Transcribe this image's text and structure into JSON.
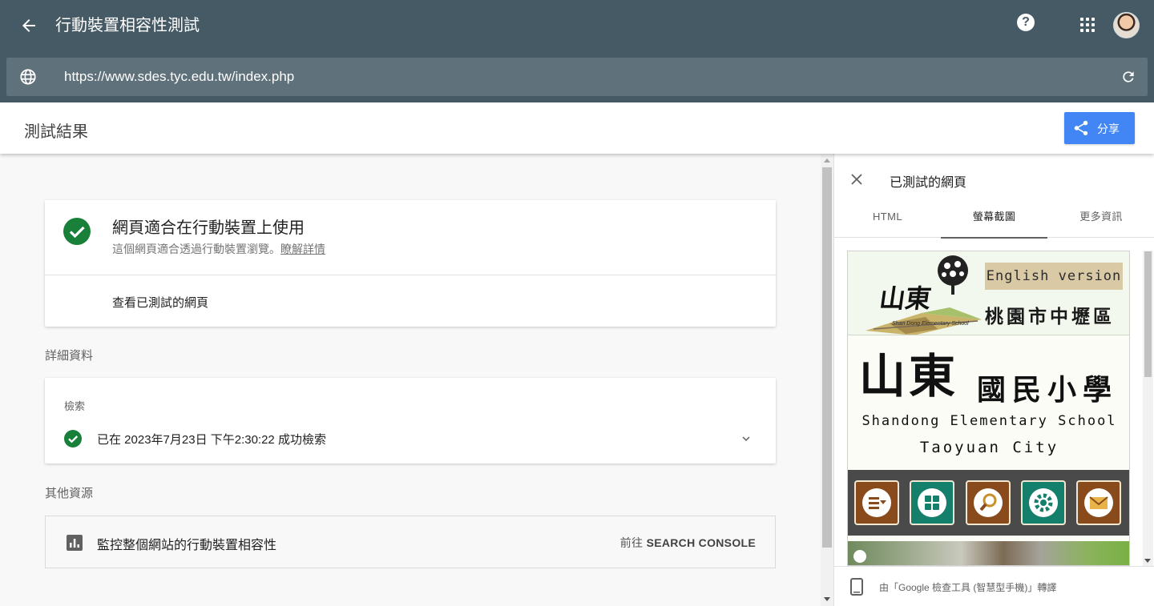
{
  "app": {
    "title": "行動裝置相容性測試",
    "help_label": "?"
  },
  "url_bar": {
    "url": "https://www.sdes.tyc.edu.tw/index.php"
  },
  "header": {
    "title": "測試結果",
    "share_label": "分享"
  },
  "result_card": {
    "title": "網頁適合在行動裝置上使用",
    "subtitle": "這個網頁適合透過行動裝置瀏覽。",
    "learn_more": "瞭解詳情",
    "view_tested_page": "查看已測試的網頁"
  },
  "details": {
    "section_label": "詳細資料",
    "crawl_label": "檢索",
    "crawl_status": "已在 2023年7月23日 下午2:30:22 成功檢索"
  },
  "resources": {
    "section_label": "其他資源",
    "monitor_text": "監控整個網站的行動裝置相容性",
    "goto_prefix": "前往",
    "goto_target": "SEARCH CONSOLE"
  },
  "panel": {
    "title": "已測試的網頁",
    "tabs": [
      {
        "label": "HTML",
        "active": false
      },
      {
        "label": "螢幕截圖",
        "active": true
      },
      {
        "label": "更多資訊",
        "active": false
      }
    ],
    "footer_text": "由「Google 檢查工具 (智慧型手機)」轉譯"
  },
  "screenshot": {
    "english_version": "English version",
    "district": "桃園市中壢區",
    "logo_text": "山東",
    "logo_subtitle": "Shan Dong Elementary School",
    "school_name_big": "山東",
    "school_name_rest": "國民小學",
    "english_name": "Shandong Elementary School",
    "city": "Taoyuan City",
    "icon_buttons": [
      {
        "icon": "menu-icon",
        "color": "#8a4b1c"
      },
      {
        "icon": "grid-icon",
        "color": "#14806b"
      },
      {
        "icon": "search-icon",
        "color": "#8a4b1c"
      },
      {
        "icon": "gear-icon",
        "color": "#14806b"
      },
      {
        "icon": "mail-icon",
        "color": "#8a4b1c"
      }
    ]
  },
  "colors": {
    "app_bar": "#455a64",
    "url_bar": "#5f717b",
    "share_button": "#4285f4",
    "success_green": "#188038"
  }
}
